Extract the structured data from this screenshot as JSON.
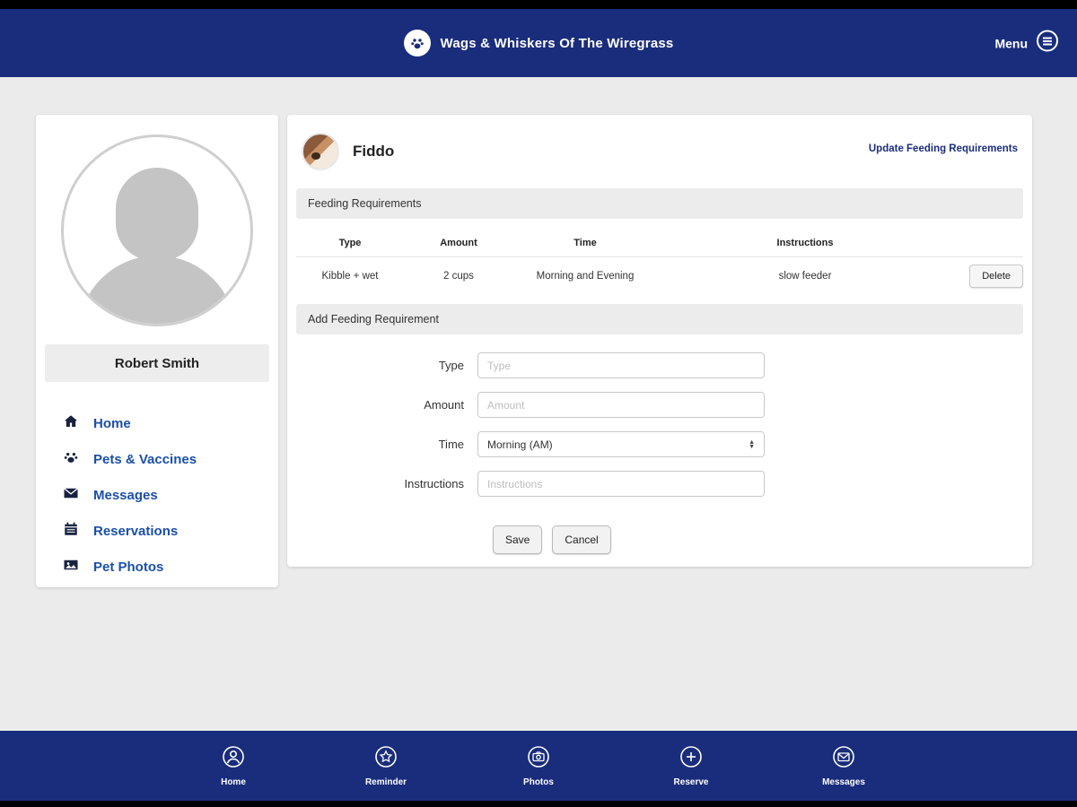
{
  "header": {
    "title": "Wags & Whiskers Of The Wiregrass",
    "menu_label": "Menu"
  },
  "sidebar": {
    "user_name": "Robert Smith",
    "nav": [
      {
        "label": "Home"
      },
      {
        "label": "Pets & Vaccines"
      },
      {
        "label": "Messages"
      },
      {
        "label": "Reservations"
      },
      {
        "label": "Pet Photos"
      }
    ]
  },
  "main": {
    "pet_name": "Fiddo",
    "update_link": "Update Feeding Requirements",
    "feeding_section_title": "Feeding Requirements",
    "table": {
      "headers": [
        "Type",
        "Amount",
        "Time",
        "Instructions"
      ],
      "rows": [
        {
          "type": "Kibble + wet",
          "amount": "2 cups",
          "time": "Morning and Evening",
          "instructions": "slow feeder",
          "delete_label": "Delete"
        }
      ]
    },
    "add_section_title": "Add Feeding Requirement",
    "form": {
      "type_label": "Type",
      "type_placeholder": "Type",
      "amount_label": "Amount",
      "amount_placeholder": "Amount",
      "time_label": "Time",
      "time_value": "Morning (AM)",
      "instructions_label": "Instructions",
      "instructions_placeholder": "Instructions",
      "save_label": "Save",
      "cancel_label": "Cancel"
    }
  },
  "footer": {
    "items": [
      {
        "label": "Home"
      },
      {
        "label": "Reminder"
      },
      {
        "label": "Photos"
      },
      {
        "label": "Reserve"
      },
      {
        "label": "Messages"
      }
    ]
  },
  "colors": {
    "navy": "#1a2d7c",
    "link_blue": "#1b4fa8"
  }
}
